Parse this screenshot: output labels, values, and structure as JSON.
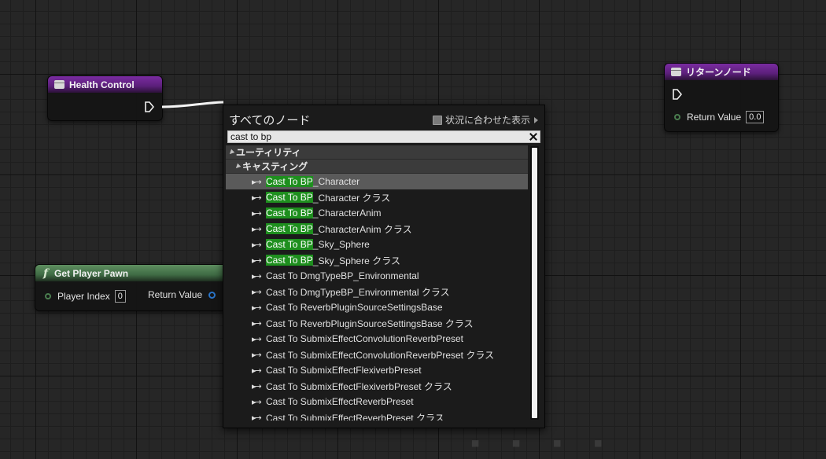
{
  "nodes": {
    "health_control": {
      "title": "Health Control"
    },
    "return_node": {
      "title": "リターンノード",
      "return_label": "Return Value",
      "return_default": "0.0"
    },
    "get_player_pawn": {
      "title": "Get Player Pawn",
      "player_index_label": "Player Index",
      "player_index_value": "0",
      "return_label": "Return Value"
    }
  },
  "popup": {
    "title": "すべてのノード",
    "context_label": "状況に合わせた表示",
    "search_value": "cast to bp",
    "categories": [
      "ユーティリティ",
      "キャスティング"
    ],
    "items": [
      {
        "hl": "Cast To BP",
        "rest": "_Character"
      },
      {
        "hl": "Cast To BP",
        "rest": "_Character クラス"
      },
      {
        "hl": "Cast To BP",
        "rest": "_CharacterAnim"
      },
      {
        "hl": "Cast To BP",
        "rest": "_CharacterAnim クラス"
      },
      {
        "hl": "Cast To BP",
        "rest": "_Sky_Sphere"
      },
      {
        "hl": "Cast To BP",
        "rest": "_Sky_Sphere クラス"
      },
      {
        "hl": "",
        "rest": "Cast To DmgTypeBP_Environmental"
      },
      {
        "hl": "",
        "rest": "Cast To DmgTypeBP_Environmental クラス"
      },
      {
        "hl": "",
        "rest": "Cast To ReverbPluginSourceSettingsBase"
      },
      {
        "hl": "",
        "rest": "Cast To ReverbPluginSourceSettingsBase クラス"
      },
      {
        "hl": "",
        "rest": "Cast To SubmixEffectConvolutionReverbPreset"
      },
      {
        "hl": "",
        "rest": "Cast To SubmixEffectConvolutionReverbPreset クラス"
      },
      {
        "hl": "",
        "rest": "Cast To SubmixEffectFlexiverbPreset"
      },
      {
        "hl": "",
        "rest": "Cast To SubmixEffectFlexiverbPreset クラス"
      },
      {
        "hl": "",
        "rest": "Cast To SubmixEffectReverbPreset"
      },
      {
        "hl": "",
        "rest": "Cast To SubmixEffectReverbPreset クラス"
      }
    ]
  }
}
